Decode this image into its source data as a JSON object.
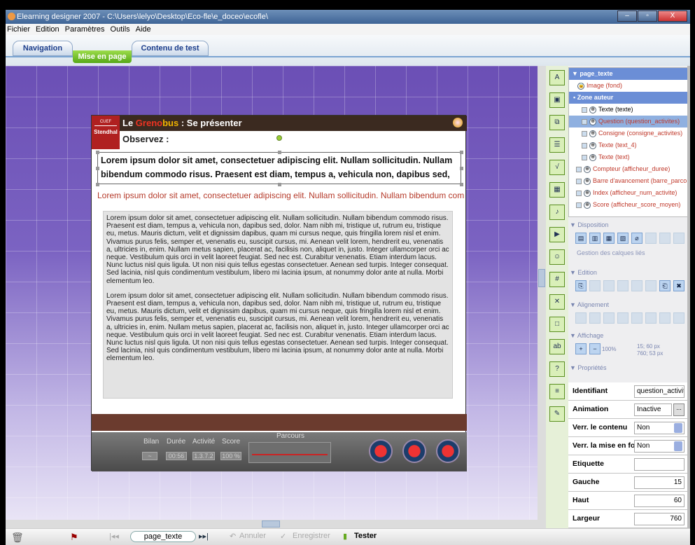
{
  "window": {
    "title": "Elearning designer 2007 - C:\\Users\\lelyo\\Desktop\\Eco-fle\\e_doceo\\ecofle\\"
  },
  "menu": [
    "Fichier",
    "Edition",
    "Paramètres",
    "Outils",
    "Aide"
  ],
  "tabs": {
    "navigation": "Navigation",
    "mise_en_page": "Mise en page",
    "contenu": "Contenu de test"
  },
  "page": {
    "title_prefix": "Le ",
    "title_grenob": "Greno",
    "title_bus": "bus",
    "title_suffix": " : Se présenter",
    "logo_text": "Stendhal",
    "observez": "Observez :",
    "question": "Lorem ipsum dolor sit amet, consectetuer adipiscing elit. Nullam sollicitudin. Nullam bibendum commodo risus. Praesent est diam, tempus a, vehicula non, dapibus sed, dolor. Nam nibh mi,",
    "consigne": "Lorem ipsum dolor sit amet, consectetuer adipiscing elit. Nullam sollicitudin. Nullam bibendum commodo",
    "para1": "Lorem ipsum dolor sit amet, consectetuer adipiscing elit. Nullam sollicitudin. Nullam bibendum commodo risus. Praesent est diam, tempus a, vehicula non, dapibus sed, dolor. Nam nibh mi, tristique ut, rutrum eu, tristique eu, metus. Mauris dictum, velit et dignissim dapibus, quam mi cursus neque, quis fringilla lorem nisl et enim. Vivamus purus felis, semper et, venenatis eu, suscipit cursus, mi. Aenean velit lorem, hendrerit eu, venenatis a, ultricies in, enim. Nullam metus sapien, placerat ac, facilisis non, aliquet in, justo. Integer ullamcorper orci ac neque. Vestibulum quis orci in velit laoreet feugiat. Sed nec est. Curabitur venenatis. Etiam interdum lacus. Nunc luctus nisl quis ligula. Ut non nisi quis tellus egestas consectetuer. Aenean sed turpis. Integer consequat. Sed lacinia, nisl quis condimentum vestibulum, libero mi lacinia ipsum, at nonummy dolor ante at nulla. Morbi elementum leo.",
    "para2": "Lorem ipsum dolor sit amet, consectetuer adipiscing elit. Nullam sollicitudin. Nullam bibendum commodo risus. Praesent est diam, tempus a, vehicula non, dapibus sed, dolor. Nam nibh mi, tristique ut, rutrum eu, tristique eu, metus. Mauris dictum, velit et dignissim dapibus, quam mi cursus neque, quis fringilla lorem nisl et enim. Vivamus purus felis, semper et, venenatis eu, suscipit cursus, mi. Aenean velit lorem, hendrerit eu, venenatis a, ultricies in, enim. Nullam metus sapien, placerat ac, facilisis non, aliquet in, justo. Integer ullamcorper orci ac neque. Vestibulum quis orci in velit laoreet feugiat. Sed nec est. Curabitur venenatis. Etiam interdum lacus. Nunc luctus nisl quis ligula. Ut non nisi quis tellus egestas consectetuer. Aenean sed turpis. Integer consequat. Sed lacinia, nisl quis condimentum vestibulum, libero mi lacinia ipsum, at nonummy dolor ante at nulla. Morbi elementum leo.",
    "footer": {
      "bilan": "Bilan",
      "duree": "Durée",
      "activite": "Activité",
      "score": "Score",
      "parcours": "Parcours",
      "duree_val": "00:56",
      "activite_val": "1.3.7.2",
      "score_val": "100 %"
    }
  },
  "tree": {
    "root": "page_texte",
    "items": [
      {
        "label": "Image (fond)",
        "color": "#c0392b"
      },
      {
        "label": "Zone auteur",
        "color": "#ffffff"
      },
      {
        "label": "Texte (texte)",
        "color": "#000000"
      },
      {
        "label": "Question (question_activites)",
        "color": "#c0392b"
      },
      {
        "label": "Consigne (consigne_activites)",
        "color": "#c0392b"
      },
      {
        "label": "Texte (text_4)",
        "color": "#c0392b"
      },
      {
        "label": "Texte (text)",
        "color": "#c0392b"
      },
      {
        "label": "Compteur (afficheur_duree)",
        "color": "#c0392b"
      },
      {
        "label": "Barre d'avancement (barre_parco",
        "color": "#c0392b"
      },
      {
        "label": "Index (afficheur_num_activite)",
        "color": "#c0392b"
      },
      {
        "label": "Score (afficheur_score_moyen)",
        "color": "#c0392b"
      }
    ]
  },
  "sections": {
    "disposition": "Disposition",
    "gestion": "Gestion des calques liés",
    "edition": "Edition",
    "alignement": "Alignement",
    "affichage": "Affichage",
    "zoom": "100%",
    "coords1": "15; 60 px",
    "coords2": "760; 53 px",
    "proprietes": "Propriétés"
  },
  "props": [
    {
      "label": "Identifiant",
      "value": "question_activit"
    },
    {
      "label": "Animation",
      "value": "Inactive"
    },
    {
      "label": "Verr. le contenu",
      "value": "Non"
    },
    {
      "label": "Verr. la mise en for",
      "value": "Non"
    },
    {
      "label": "Etiquette",
      "value": ""
    },
    {
      "label": "Gauche",
      "value": "15"
    },
    {
      "label": "Haut",
      "value": "60"
    },
    {
      "label": "Largeur",
      "value": "760"
    }
  ],
  "bottom": {
    "page": "page_texte",
    "annuler": "Annuler",
    "enregistrer": "Enregistrer",
    "tester": "Tester"
  }
}
